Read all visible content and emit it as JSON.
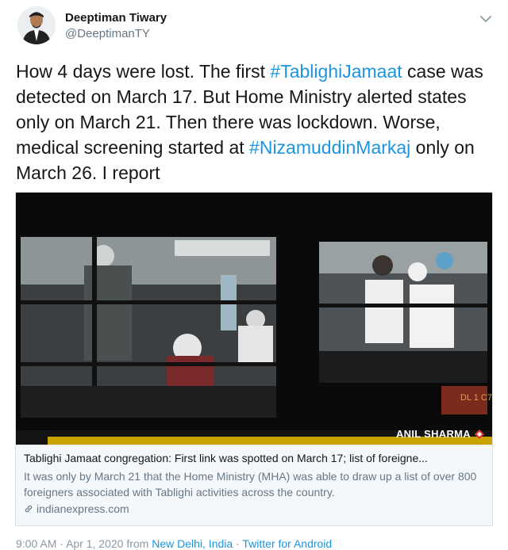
{
  "author": {
    "name": "Deeptiman Tiwary",
    "handle": "@DeeptimanTY",
    "avatar_icon": "person-portrait"
  },
  "tweet": {
    "text_parts": [
      "How 4 days were lost. The first ",
      "#TablighiJamaat",
      " case was detected on March 17. But Home Ministry alerted states only on March 21. Then there was lockdown. Worse, medical screening started at ",
      "#NizamuddinMarkaj",
      " only on March 26. I report"
    ]
  },
  "card": {
    "image_credit": "ANIL SHARMA",
    "title": "Tablighi Jamaat congregation: First link was spotted on March 17; list of foreigne...",
    "description": "It was only by March 21 that the Home Ministry (MHA) was able to draw up a list of over 800 foreigners associated with Tablighi activities across the country.",
    "domain": "indianexpress.com",
    "bus_plate": "DL 1 C75"
  },
  "meta": {
    "time": "9:00 AM",
    "date": "Apr 1, 2020",
    "from_word": "from",
    "location": "New Delhi, India",
    "separator": "·",
    "source": "Twitter for Android"
  },
  "colors": {
    "hashtag": "#1b95e0",
    "muted": "#657786",
    "text": "#14171a"
  }
}
